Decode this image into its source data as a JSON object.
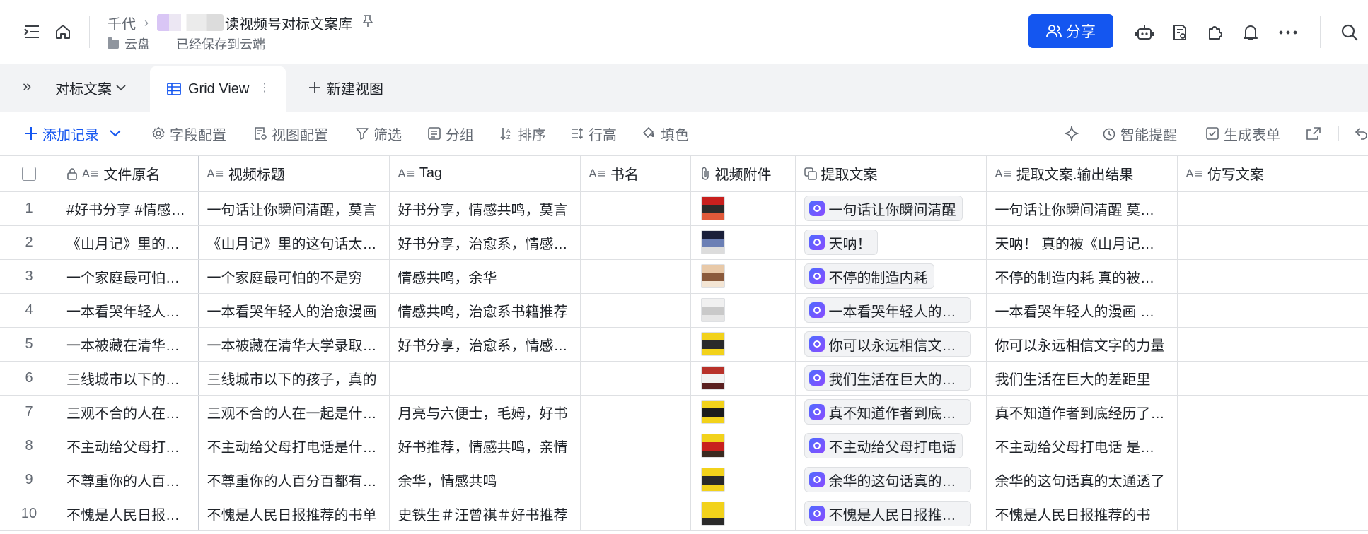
{
  "header": {
    "breadcrumb_parent": "千代",
    "doc_title": "读视频号对标文案库",
    "location": "云盘",
    "save_status": "已经保存到云端",
    "share_label": "分享"
  },
  "tabs": {
    "table_name": "对标文案",
    "active_view": "Grid View",
    "new_view": "新建视图"
  },
  "toolbar": {
    "add_record": "添加记录",
    "field_config": "字段配置",
    "view_config": "视图配置",
    "filter": "筛选",
    "group": "分组",
    "sort": "排序",
    "row_height": "行高",
    "fill_color": "填色",
    "smart_reminder": "智能提醒",
    "generate_form": "生成表单"
  },
  "columns": [
    "文件原名",
    "视频标题",
    "Tag",
    "书名",
    "视频附件",
    "提取文案",
    "提取文案.输出结果",
    "仿写文案"
  ],
  "rows": [
    {
      "num": "1",
      "file": "#好书分享 #情感共鸣",
      "title": "一句话让你瞬间清醒，莫言",
      "tag": "好书分享，情感共鸣，莫言",
      "book": "",
      "thumb": [
        "#c8201e",
        "#2b2b2b",
        "#e05a3a"
      ],
      "extract": "一句话让你瞬间清醒",
      "result": "一句话让你瞬间清醒 莫言说",
      "rewrite": ""
    },
    {
      "num": "2",
      "file": "《山月记》里的这句话",
      "title": "《山月记》里的这句话太戳人了",
      "tag": "好书分享，治愈系，情感共鸣",
      "book": "",
      "thumb": [
        "#1a1f3a",
        "#6b7fb5",
        "#dcdcdc"
      ],
      "extract": "天呐！",
      "result": "天呐！ 真的被《山月记》戳中了",
      "rewrite": ""
    },
    {
      "num": "3",
      "file": "一个家庭最可怕的不是穷",
      "title": "一个家庭最可怕的不是穷",
      "tag": "情感共鸣，余华",
      "book": "",
      "thumb": [
        "#e8c9a8",
        "#8a5a3c",
        "#f3e5d4"
      ],
      "extract": "不停的制造内耗",
      "result": "不停的制造内耗 真的被掏空了",
      "rewrite": ""
    },
    {
      "num": "4",
      "file": "一本看哭年轻人的治愈漫画",
      "title": "一本看哭年轻人的治愈漫画",
      "tag": "情感共鸣，治愈系书籍推荐",
      "book": "",
      "thumb": [
        "#f0f0f0",
        "#c9c9c9",
        "#e6e6e6"
      ],
      "extract": "一本看哭年轻人的漫画",
      "result": "一本看哭年轻人的漫画 治愈",
      "rewrite": ""
    },
    {
      "num": "5",
      "file": "一本被藏在清华大学录取书单",
      "title": "一本被藏在清华大学录取书单里",
      "tag": "好书分享，治愈系，情感共鸣",
      "book": "",
      "thumb": [
        "#f2d21b",
        "#2a2a2a",
        "#f2d21b"
      ],
      "extract": "你可以永远相信文字的力量",
      "result": "你可以永远相信文字的力量",
      "rewrite": ""
    },
    {
      "num": "6",
      "file": "三线城市以下的孩子",
      "title": "三线城市以下的孩子，真的",
      "tag": "",
      "book": "",
      "thumb": [
        "#b8322a",
        "#f2f2f2",
        "#5a2020"
      ],
      "extract": "我们生活在巨大的差距里",
      "result": "我们生活在巨大的差距里",
      "rewrite": ""
    },
    {
      "num": "7",
      "file": "三观不合的人在一起",
      "title": "三观不合的人在一起是什么样",
      "tag": "月亮与六便士，毛姆，好书",
      "book": "",
      "thumb": [
        "#f2d21b",
        "#1c1c1c",
        "#f2d21b"
      ],
      "extract": "真不知道作者到底经历了什么",
      "result": "真不知道作者到底经历了什么",
      "rewrite": ""
    },
    {
      "num": "8",
      "file": "不主动给父母打电话",
      "title": "不主动给父母打电话是什么心理",
      "tag": "好书推荐，情感共鸣，亲情",
      "book": "",
      "thumb": [
        "#f2d21b",
        "#c8201e",
        "#3a2a20"
      ],
      "extract": "不主动给父母打电话",
      "result": "不主动给父母打电话 是因为",
      "rewrite": ""
    },
    {
      "num": "9",
      "file": "不尊重你的人百分百都",
      "title": "不尊重你的人百分百都有这些",
      "tag": "余华，情感共鸣",
      "book": "",
      "thumb": [
        "#f2d21b",
        "#2a2a2a",
        "#f2d21b"
      ],
      "extract": "余华的这句话真的太通透了",
      "result": "余华的这句话真的太通透了",
      "rewrite": ""
    },
    {
      "num": "10",
      "file": "不愧是人民日报推荐的",
      "title": "不愧是人民日报推荐的书单",
      "tag": "史铁生＃汪曾祺＃好书推荐",
      "book": "",
      "thumb": [
        "#f2d21b",
        "#f2d21b",
        "#2a2a2a"
      ],
      "extract": "不愧是人民日报推荐的",
      "result": "不愧是人民日报推荐的书",
      "rewrite": ""
    }
  ]
}
